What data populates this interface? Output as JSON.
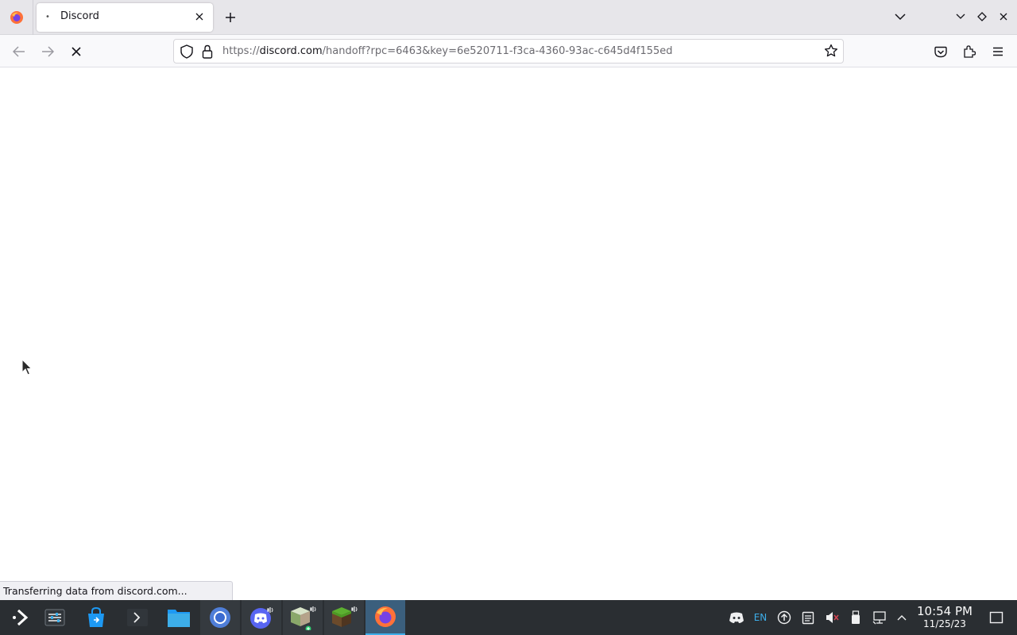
{
  "browser": {
    "tab": {
      "title": "Discord",
      "loading_indicator": "•"
    },
    "url": {
      "scheme": "https://",
      "host": "discord.com",
      "path": "/handoff?rpc=6463&key=6e520711-f3ca-4360-93ac-c645d4f155ed"
    },
    "status_text": "Transferring data from discord.com..."
  },
  "taskbar": {
    "items": [
      {
        "name": "app-launcher",
        "state": "normal"
      },
      {
        "name": "system-settings",
        "state": "normal"
      },
      {
        "name": "discover-store",
        "state": "normal"
      },
      {
        "name": "konsole",
        "state": "normal"
      },
      {
        "name": "file-manager",
        "state": "normal"
      },
      {
        "name": "chromium",
        "state": "running"
      },
      {
        "name": "discord",
        "state": "running"
      },
      {
        "name": "minetest",
        "state": "running"
      },
      {
        "name": "minecraft",
        "state": "running"
      },
      {
        "name": "firefox",
        "state": "active"
      }
    ],
    "tray": {
      "keyboard_layout": "EN"
    },
    "clock": {
      "time": "10:54 PM",
      "date": "11/25/23"
    }
  },
  "colors": {
    "accent": "#3daee9",
    "discord": "#5865f2",
    "firefox_orange": "#ff7139",
    "taskbar_bg": "#2a2e32"
  }
}
